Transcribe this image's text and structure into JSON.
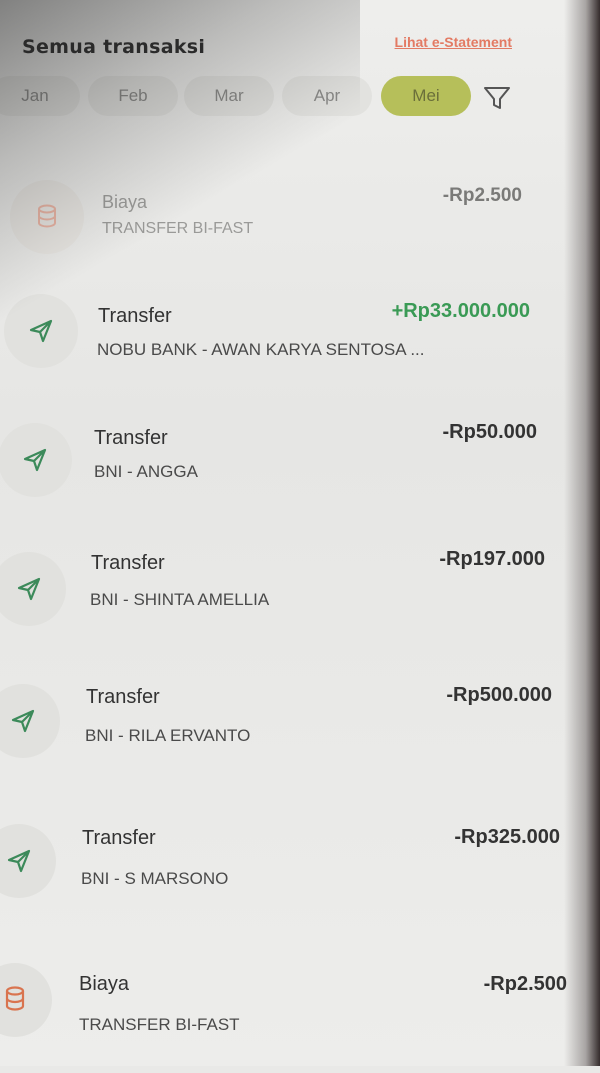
{
  "header": {
    "title": "Semua transaksi",
    "estatement_link": "Lihat e-Statement"
  },
  "months": [
    {
      "label": "Jan",
      "active": false
    },
    {
      "label": "Feb",
      "active": false
    },
    {
      "label": "Mar",
      "active": false
    },
    {
      "label": "Apr",
      "active": false
    },
    {
      "label": "Mei",
      "active": true
    }
  ],
  "colors": {
    "accent": "#b6bf5a",
    "positive": "#3a9a55",
    "link": "#e37a63"
  },
  "transactions": [
    {
      "icon": "fee-coins-icon",
      "title": "Biaya",
      "subtitle": "TRANSFER BI-FAST",
      "amount": "-Rp2.500",
      "positive": false
    },
    {
      "icon": "send-icon",
      "title": "Transfer",
      "subtitle": "NOBU BANK - AWAN KARYA SENTOSA ...",
      "amount": "+Rp33.000.000",
      "positive": true
    },
    {
      "icon": "send-icon",
      "title": "Transfer",
      "subtitle": "BNI - ANGGA",
      "amount": "-Rp50.000",
      "positive": false
    },
    {
      "icon": "send-icon",
      "title": "Transfer",
      "subtitle": "BNI - SHINTA AMELLIA",
      "amount": "-Rp197.000",
      "positive": false
    },
    {
      "icon": "send-icon",
      "title": "Transfer",
      "subtitle": "BNI - RILA ERVANTO",
      "amount": "-Rp500.000",
      "positive": false
    },
    {
      "icon": "send-icon",
      "title": "Transfer",
      "subtitle": "BNI - S MARSONO",
      "amount": "-Rp325.000",
      "positive": false
    },
    {
      "icon": "fee-coins-icon",
      "title": "Biaya",
      "subtitle": "TRANSFER BI-FAST",
      "amount": "-Rp2.500",
      "positive": false
    }
  ]
}
